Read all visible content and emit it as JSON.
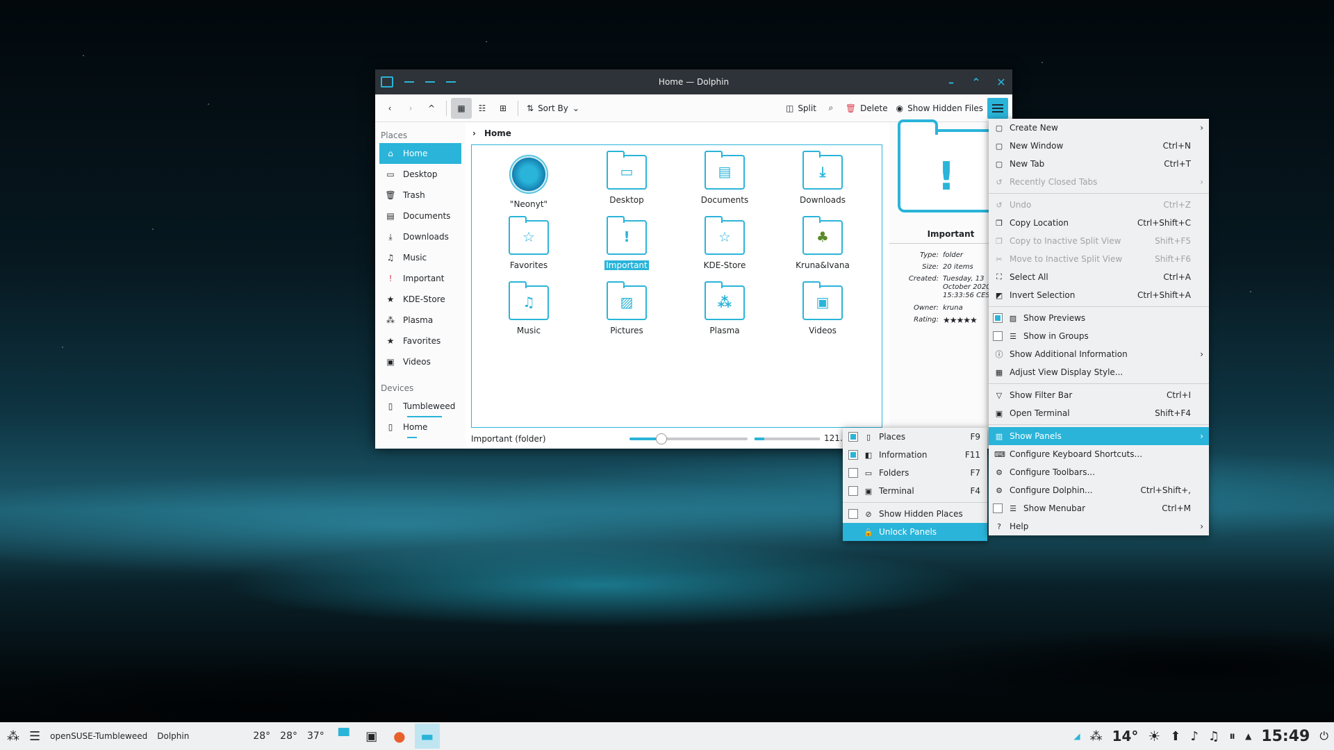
{
  "window": {
    "title": "Home — Dolphin"
  },
  "toolbar": {
    "sort_by": "Sort By",
    "split": "Split",
    "delete": "Delete",
    "show_hidden": "Show Hidden Files"
  },
  "places": {
    "header": "Places",
    "items": [
      "Home",
      "Desktop",
      "Trash",
      "Documents",
      "Downloads",
      "Music",
      "Important",
      "KDE-Store",
      "Plasma",
      "Favorites",
      "Videos"
    ],
    "devices_header": "Devices",
    "devices": [
      "Tumbleweed",
      "Home"
    ]
  },
  "breadcrumb": "Home",
  "files": [
    "\"Neonyt\"",
    "Desktop",
    "Documents",
    "Downloads",
    "Favorites",
    "Important",
    "KDE-Store",
    "Kruna&Ivana",
    "Music",
    "Pictures",
    "Plasma",
    "Videos"
  ],
  "info": {
    "name": "Important",
    "type_k": "Type:",
    "type_v": "folder",
    "size_k": "Size:",
    "size_v": "20 items",
    "created_k": "Created:",
    "created_v": "Tuesday, 13 October 2020 15:33:56 CEST",
    "owner_k": "Owner:",
    "owner_v": "kruna",
    "rating_k": "Rating:",
    "rating_stars": "★★★★★"
  },
  "status": {
    "text": "Important (folder)",
    "zoom": "121."
  },
  "main_menu": [
    {
      "label": "Create New",
      "submenu": true
    },
    {
      "label": "New Window",
      "shortcut": "Ctrl+N"
    },
    {
      "label": "New Tab",
      "shortcut": "Ctrl+T"
    },
    {
      "label": "Recently Closed Tabs",
      "submenu": true,
      "disabled": true
    },
    {
      "label": "Undo",
      "shortcut": "Ctrl+Z",
      "disabled": true
    },
    {
      "label": "Copy Location",
      "shortcut": "Ctrl+Shift+C"
    },
    {
      "label": "Copy to Inactive Split View",
      "shortcut": "Shift+F5",
      "disabled": true
    },
    {
      "label": "Move to Inactive Split View",
      "shortcut": "Shift+F6",
      "disabled": true
    },
    {
      "label": "Select All",
      "shortcut": "Ctrl+A"
    },
    {
      "label": "Invert Selection",
      "shortcut": "Ctrl+Shift+A"
    },
    {
      "label": "Show Previews",
      "checked": true
    },
    {
      "label": "Show in Groups",
      "checked": false
    },
    {
      "label": "Show Additional Information",
      "submenu": true
    },
    {
      "label": "Adjust View Display Style..."
    },
    {
      "label": "Show Filter Bar",
      "shortcut": "Ctrl+I"
    },
    {
      "label": "Open Terminal",
      "shortcut": "Shift+F4"
    },
    {
      "label": "Show Panels",
      "submenu": true,
      "highlighted": true
    },
    {
      "label": "Configure Keyboard Shortcuts..."
    },
    {
      "label": "Configure Toolbars..."
    },
    {
      "label": "Configure Dolphin...",
      "shortcut": "Ctrl+Shift+,"
    },
    {
      "label": "Show Menubar",
      "shortcut": "Ctrl+M",
      "checked": false
    },
    {
      "label": "Help",
      "submenu": true
    }
  ],
  "panels_menu": [
    {
      "label": "Places",
      "shortcut": "F9",
      "checked": true
    },
    {
      "label": "Information",
      "shortcut": "F11",
      "checked": true
    },
    {
      "label": "Folders",
      "shortcut": "F7",
      "checked": false
    },
    {
      "label": "Terminal",
      "shortcut": "F4",
      "checked": false
    },
    {
      "label": "Show Hidden Places",
      "checked": false
    },
    {
      "label": "Unlock Panels",
      "highlighted": true
    }
  ],
  "taskbar": {
    "hostname": "openSUSE-Tumbleweed",
    "app": "Dolphin",
    "temps": [
      "28°",
      "28°",
      "37°"
    ],
    "weather": "14°",
    "clock": "15:49"
  },
  "colors": {
    "accent": "#2ab4d9",
    "titlebar": "#2d3338",
    "menu_bg": "#eff0f1"
  }
}
